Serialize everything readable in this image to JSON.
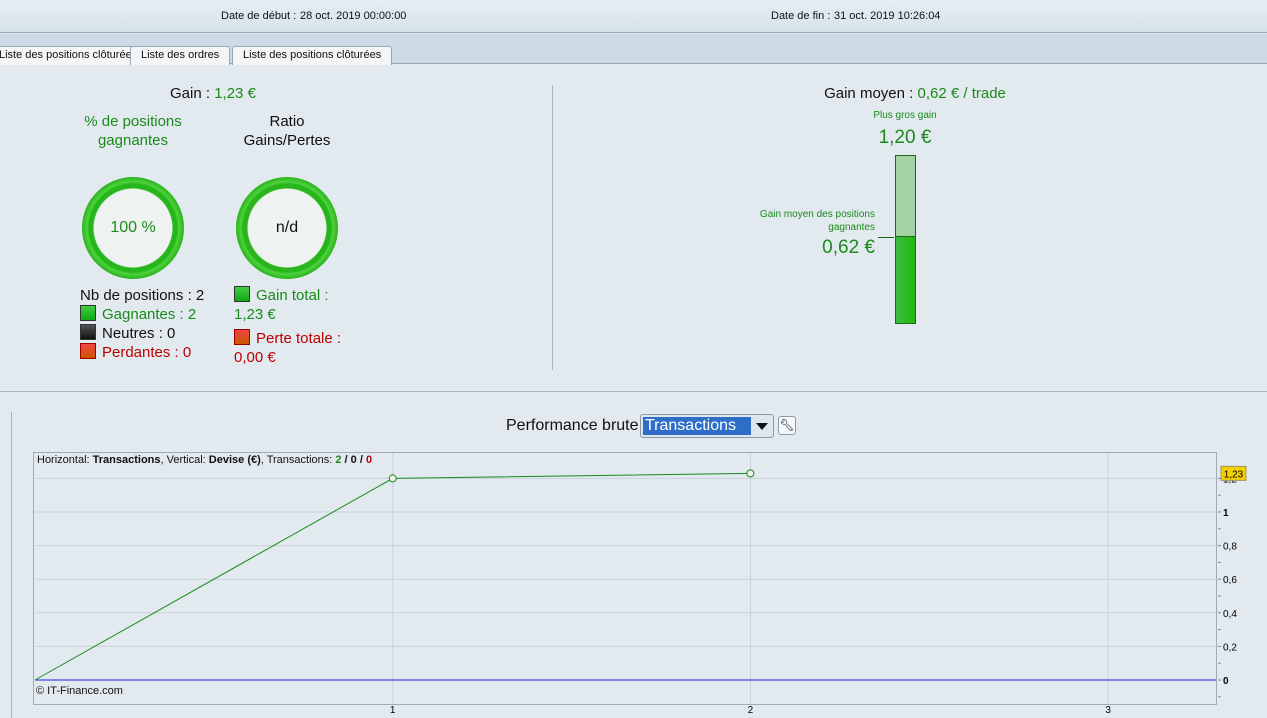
{
  "header": {
    "start_label": "Date de début :",
    "start_value": "28 oct. 2019 00:00:00",
    "end_label": "Date de fin :",
    "end_value": "31 oct. 2019 10:26:04"
  },
  "tabs": [
    "Liste des positions clôturées",
    "Liste des ordres",
    "Liste des positions clôturées"
  ],
  "summary": {
    "gain_label": "Gain :",
    "gain_value": "1,23 €",
    "pct_title": "% de positions gagnantes",
    "pct_value": "100 %",
    "pct_fraction": 1.0,
    "ratio_title": "Ratio Gains/Pertes",
    "ratio_value": "n/d",
    "nb_positions": "Nb de positions : 2",
    "winners": "Gagnantes : 2",
    "neutral": "Neutres : 0",
    "losers": "Perdantes : 0",
    "gain_total_label": "Gain total :",
    "gain_total_value": "1,23 €",
    "loss_total_label": "Perte totale :",
    "loss_total_value": "0,00 €"
  },
  "average": {
    "label": "Gain moyen :",
    "value": "0,62 € / trade",
    "max_label": "Plus gros gain",
    "max_value": "1,20 €",
    "avg_win_label": "Gain moyen des positions gagnantes",
    "avg_win_value": "0,62 €",
    "fill_fraction": 0.52
  },
  "perf": {
    "label": "Performance brute",
    "select_value": "Transactions",
    "info_h": "Horizontal: ",
    "info_h_val": "Transactions",
    "info_v": ", Vertical: ",
    "info_v_val": "Devise (€)",
    "info_t": ", Transactions: ",
    "t_win": "2",
    "t_neu": "0",
    "t_loss": "0",
    "copyright": "© IT-Finance.com"
  },
  "colors": {
    "green": "#1a8a1a",
    "red": "#b00000",
    "blue": "#2020e0",
    "bg": "#e2eaf0"
  },
  "chart_data": {
    "type": "line",
    "xlabel": "Transactions",
    "ylabel": "Devise (€)",
    "x": [
      0,
      1,
      2
    ],
    "values": [
      0,
      1.2,
      1.23
    ],
    "xlim": [
      0,
      3.3
    ],
    "ylim": [
      -0.14,
      1.36
    ],
    "xticks": [
      "1",
      "2",
      "3"
    ],
    "yticks": [
      "0",
      "0,2",
      "0,4",
      "0,6",
      "0,8",
      "1",
      "1,2"
    ],
    "last_value_label": "1,23"
  }
}
